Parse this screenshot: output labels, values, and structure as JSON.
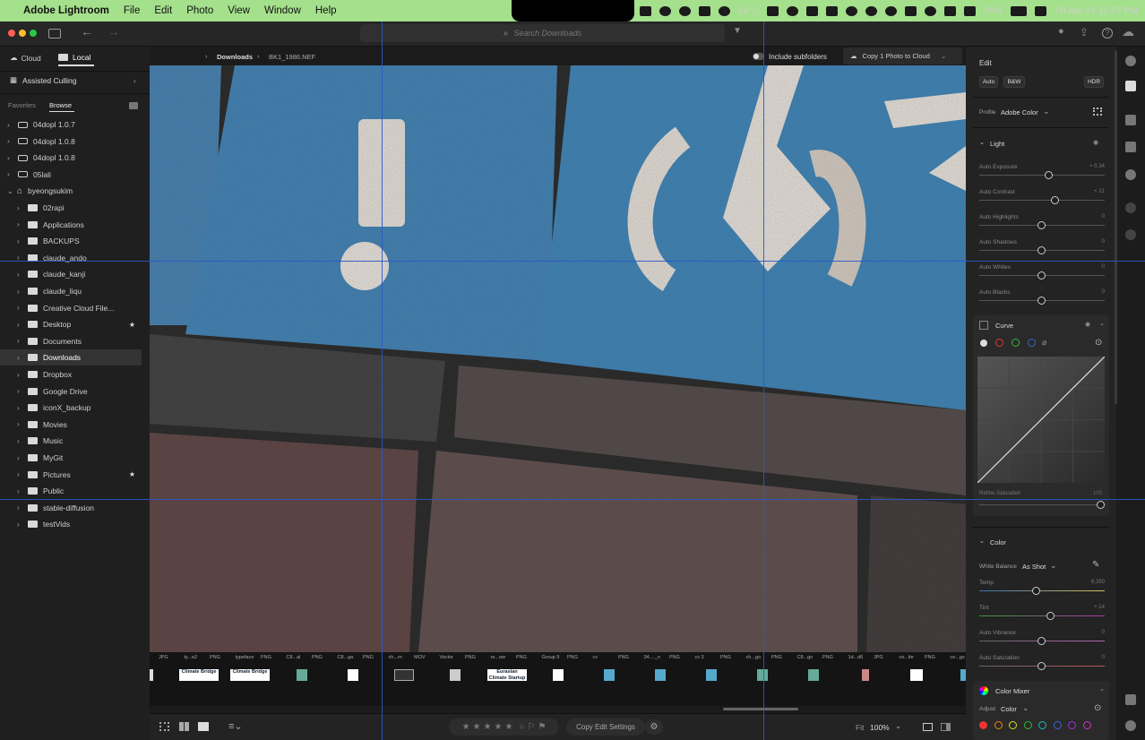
{
  "menubar": {
    "app": "Adobe Lightroom",
    "items": [
      "File",
      "Edit",
      "Photo",
      "View",
      "Window",
      "Help"
    ],
    "temp": "14°C",
    "battery": "29%",
    "clock": "Fri Apr 24  11:47 PM"
  },
  "toolbar": {
    "search_placeholder": "Search Downloads"
  },
  "sidebar": {
    "tab_cloud": "Cloud",
    "tab_local": "Local",
    "assisted_culling": "Assisted Culling",
    "favorites": "Favorites",
    "browse": "Browse",
    "drives": [
      "04dopl 1.0.7",
      "04dopl 1.0.8",
      "04dopl 1.0.8",
      "05lali"
    ],
    "home": "byeongsukim",
    "folders": [
      "02rapi",
      "Applications",
      "BACKUPS",
      "claude_ando",
      "claude_kanji",
      "claude_liqu",
      "Creative Cloud File...",
      "Desktop",
      "Documents",
      "Downloads",
      "Dropbox",
      "Google Drive",
      "iconX_backup",
      "Movies",
      "Music",
      "MyGit",
      "Pictures",
      "Public",
      "stable-diffusion",
      "testVids"
    ],
    "selected": "Downloads"
  },
  "breadcrumb": {
    "parent": "Downloads",
    "file": "BK1_1986.NEF"
  },
  "header": {
    "include_subfolders": "Include subfolders",
    "copy_cloud": "Copy 1 Photo to Cloud"
  },
  "filmstrip": {
    "labels": [
      "JPG",
      "ty...e2",
      "PNG",
      "typeface",
      "PNG",
      "C8...al",
      "PNG",
      "C8...ga",
      "PNG",
      "ch...rn",
      "MOV",
      "Vector",
      "PNG",
      "re...ow",
      "PNG",
      "Group 9",
      "PNG",
      "cv",
      "PNG",
      "34...._n",
      "PNG",
      "cv 3",
      "PNG",
      "ch...go",
      "PNG",
      "C8...go",
      "PNG",
      "1d...d6",
      "JPG",
      "ce...ite",
      "PNG",
      "ce...gs"
    ],
    "thumb_texts": [
      "Climate Bridge",
      "Climate Bridge",
      "Eurasian Climate Startup Report"
    ]
  },
  "bottombar": {
    "copy_edit": "Copy Edit Settings",
    "fit": "Fit",
    "zoom": "100%"
  },
  "edit": {
    "title": "Edit",
    "auto": "Auto",
    "bw": "B&W",
    "hdr": "HDR",
    "profile_label": "Profile",
    "profile_value": "Adobe Color",
    "light": {
      "title": "Light",
      "sliders": [
        {
          "label": "Auto Exposure",
          "value": "+ 0.34",
          "pos": 0.56
        },
        {
          "label": "Auto Contrast",
          "value": "+ 21",
          "pos": 0.61
        },
        {
          "label": "Auto Highlights",
          "value": "0",
          "pos": 0.5
        },
        {
          "label": "Auto Shadows",
          "value": "0",
          "pos": 0.5
        },
        {
          "label": "Auto Whites",
          "value": "0",
          "pos": 0.5
        },
        {
          "label": "Auto Blacks",
          "value": "0",
          "pos": 0.5
        }
      ]
    },
    "curve": {
      "title": "Curve",
      "refine": "Refine Saturation",
      "refine_value": "100"
    },
    "color": {
      "title": "Color",
      "wb_label": "White Balance",
      "wb_value": "As Shot",
      "sliders": [
        {
          "label": "Temp",
          "value": "6,350",
          "pos": 0.46
        },
        {
          "label": "Tint",
          "value": "+ 14",
          "pos": 0.57
        },
        {
          "label": "Auto Vibrance",
          "value": "0",
          "pos": 0.5
        },
        {
          "label": "Auto Saturation",
          "value": "0",
          "pos": 0.5
        }
      ]
    },
    "mixer": {
      "title": "Color Mixer",
      "adjust_label": "Adjust",
      "adjust_value": "Color"
    }
  },
  "colors": {
    "menubar": "#a5e08c",
    "guide": "#2a56c9",
    "tile_blue": "#3a7fb0"
  }
}
